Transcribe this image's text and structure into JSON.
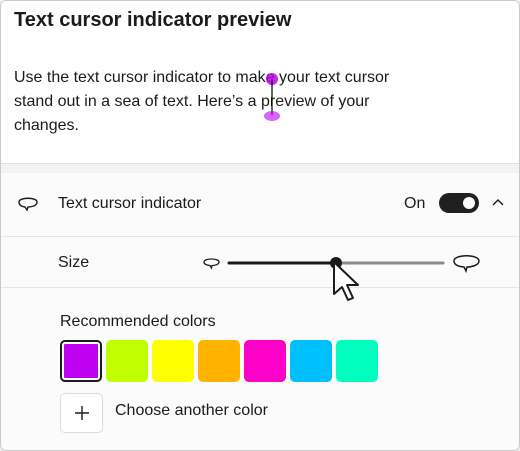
{
  "preview": {
    "title": "Text cursor indicator preview",
    "line1": "Use the text cursor indicator to make your text cursor",
    "line2": "stand out in a sea of text. Here’s a preview of your",
    "line3": "changes."
  },
  "indicator": {
    "label": "Text cursor indicator",
    "state_label": "On",
    "enabled": true,
    "icon": "cursor-indicator-icon"
  },
  "size": {
    "label": "Size",
    "slider_value": 0.47
  },
  "colors": {
    "title": "Recommended colors",
    "swatches": [
      "#c000f0",
      "#c0ff00",
      "#ffff00",
      "#ffb300",
      "#ff00c8",
      "#00bfff",
      "#00ffbf"
    ],
    "selected_index": 0,
    "add_label": "Choose another color",
    "accent": "#202020",
    "indicator_color": "#c000f0"
  }
}
